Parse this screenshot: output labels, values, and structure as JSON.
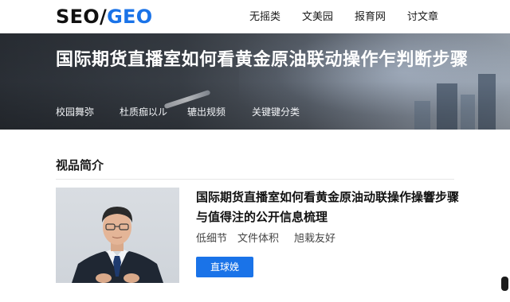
{
  "header": {
    "logo": {
      "seo": "SEO",
      "slash": "/",
      "geo": "GEO"
    },
    "nav": [
      "无摇类",
      "文美园",
      "报育网",
      "讨文章"
    ]
  },
  "hero": {
    "title": "国际期货直播室如何看黄金原油联动操作乍判断步骤",
    "tags": [
      "校园舞弥",
      "杜质痂以ル",
      "辘出规频",
      "关键键分类"
    ]
  },
  "section": {
    "title": "视品简介"
  },
  "card": {
    "title": "国际期货直播室如何看黄金原油动联操作操響步骤与值得注的公开信息梳理",
    "meta": [
      "低细节",
      "文件体积",
      "旭栽友好"
    ],
    "cta_label": "直球娩"
  },
  "colors": {
    "brand_blue": "#1a73e8",
    "text_dark": "#1a1a1a"
  }
}
